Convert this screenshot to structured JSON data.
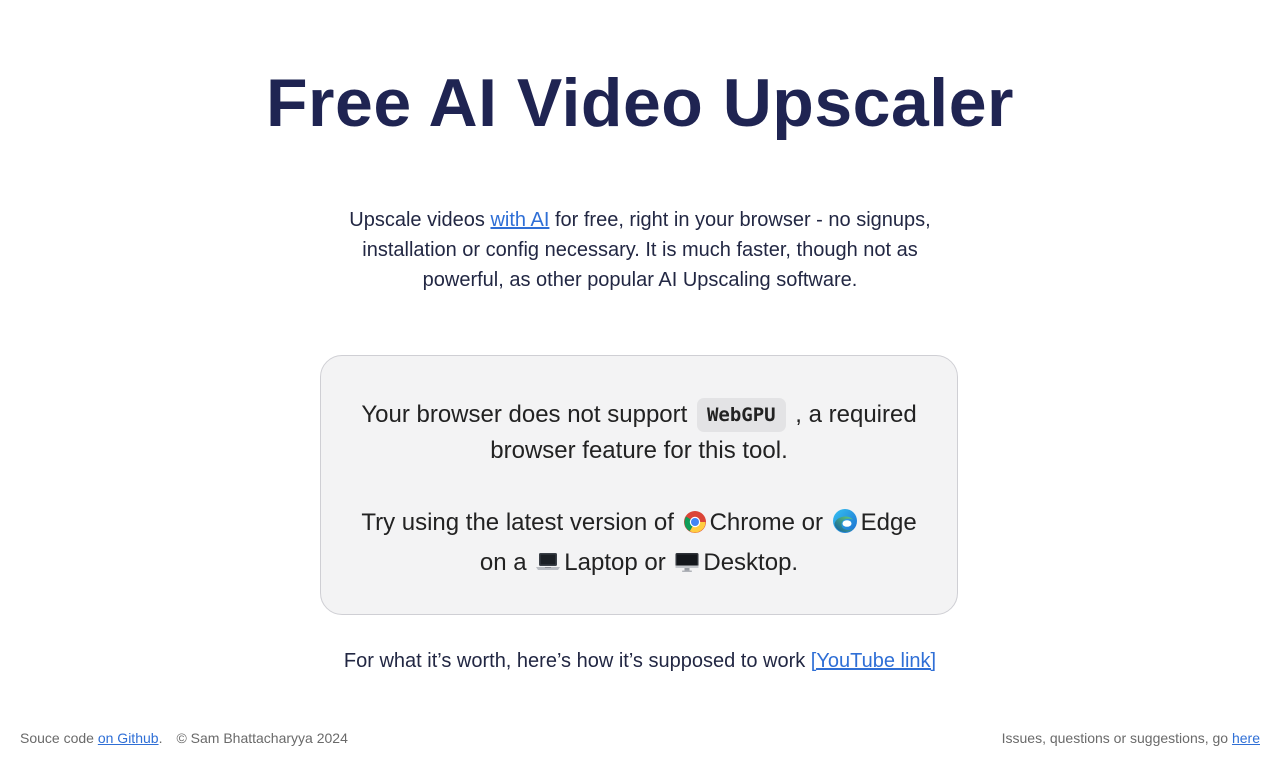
{
  "header": {
    "title": "Free AI Video Upscaler"
  },
  "intro": {
    "before_link": "Upscale videos ",
    "link_text": "with AI",
    "after_link": " for free, right in your browser - no signups, installation or config necessary. It is much faster, though not as powerful, as other popular AI Upscaling software."
  },
  "notice": {
    "line1_before": "Your browser does not support ",
    "code": "WebGPU",
    "line1_after": " , a required browser feature for this tool.",
    "try_before": "Try using the latest version of ",
    "chrome": "Chrome",
    "or1": " or ",
    "edge": "Edge",
    "on_a": " on a ",
    "laptop": "Laptop",
    "or2": " or ",
    "desktop": "Desktop."
  },
  "worth": {
    "text": "For what it’s worth, here’s how it’s supposed to work ",
    "link_text": "[YouTube link]"
  },
  "footer": {
    "source_prefix": "Souce code ",
    "source_link": "on Github",
    "source_suffix": ".",
    "copyright": "© Sam Bhattacharyya 2024",
    "issues_text": "Issues, questions or suggestions, go ",
    "issues_link": "here"
  },
  "colors": {
    "title": "#1f2452",
    "link": "#2f6fd6",
    "card_bg": "#f3f3f4"
  }
}
